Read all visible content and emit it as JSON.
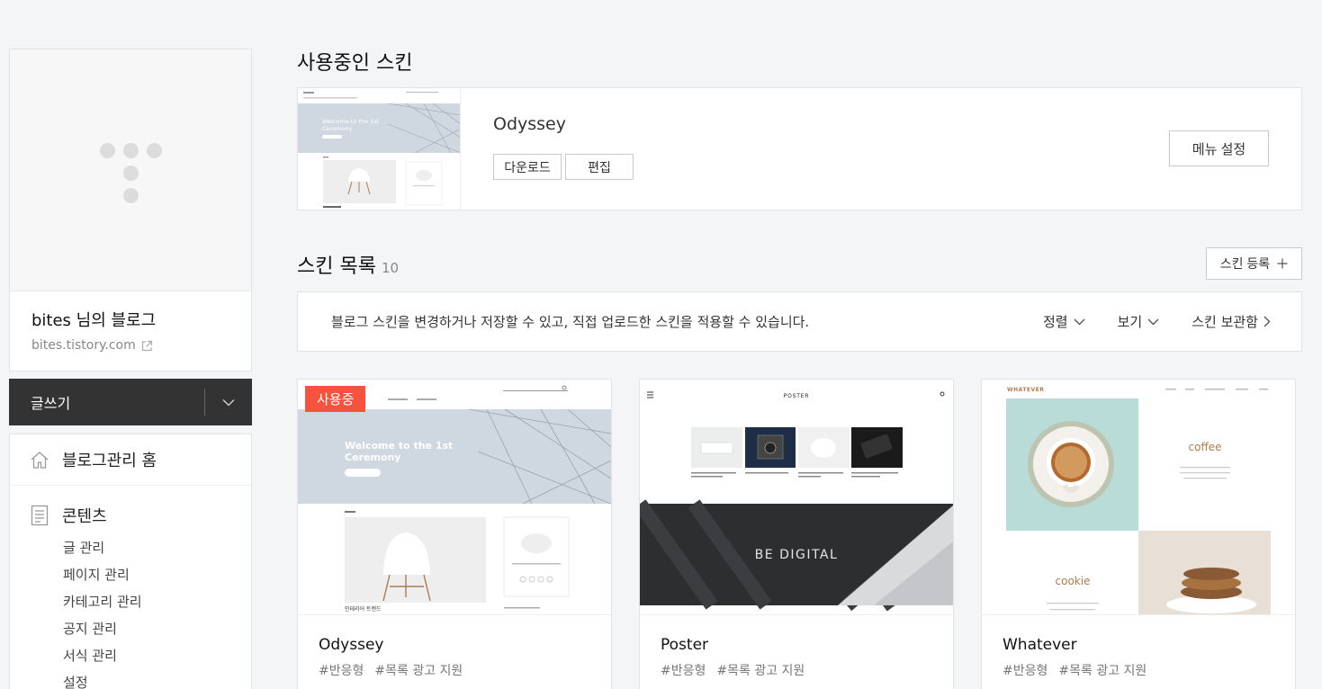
{
  "sidebar": {
    "blog_name": "bites 님의 블로그",
    "blog_url": "bites.tistory.com",
    "write_label": "글쓰기",
    "menu": {
      "home_label": "블로그관리 홈",
      "content_label": "콘텐츠",
      "content_items": [
        "글 관리",
        "페이지 관리",
        "카테고리 관리",
        "공지 관리",
        "서식 관리",
        "설정"
      ]
    }
  },
  "current_skin": {
    "section_title": "사용중인 스킨",
    "name": "Odyssey",
    "download_label": "다운로드",
    "edit_label": "편집",
    "menu_settings_label": "메뉴 설정",
    "thumb": {
      "hero_text_1": "Welcome to the 1st",
      "hero_text_2": "Ceremony"
    }
  },
  "skin_list": {
    "section_title": "스킨 목록",
    "count": "10",
    "register_label": "스킨 등록",
    "info_text": "블로그 스킨을 변경하거나 저장할 수 있고, 직접 업로드한 스킨을 적용할 수 있습니다.",
    "sort_label": "정렬",
    "view_label": "보기",
    "storage_label": "스킨 보관함",
    "cards": [
      {
        "name": "Odyssey",
        "tags": [
          "#반응형",
          "#목록 광고 지원"
        ],
        "badge": "사용중",
        "thumb_text": [
          "Welcome to the 1st",
          "Ceremony",
          "인테리어 트렌드"
        ]
      },
      {
        "name": "Poster",
        "tags": [
          "#반응형",
          "#목록 광고 지원"
        ],
        "thumb_text": [
          "POSTER",
          "BE DIGITAL"
        ]
      },
      {
        "name": "Whatever",
        "tags": [
          "#반응형",
          "#목록 광고 지원"
        ],
        "thumb_text": [
          "WHATEVER",
          "coffee",
          "cookie"
        ]
      }
    ]
  },
  "colors": {
    "accent_badge": "#f5533d",
    "write_bar": "#333333",
    "page_bg": "#f4f5f7"
  }
}
